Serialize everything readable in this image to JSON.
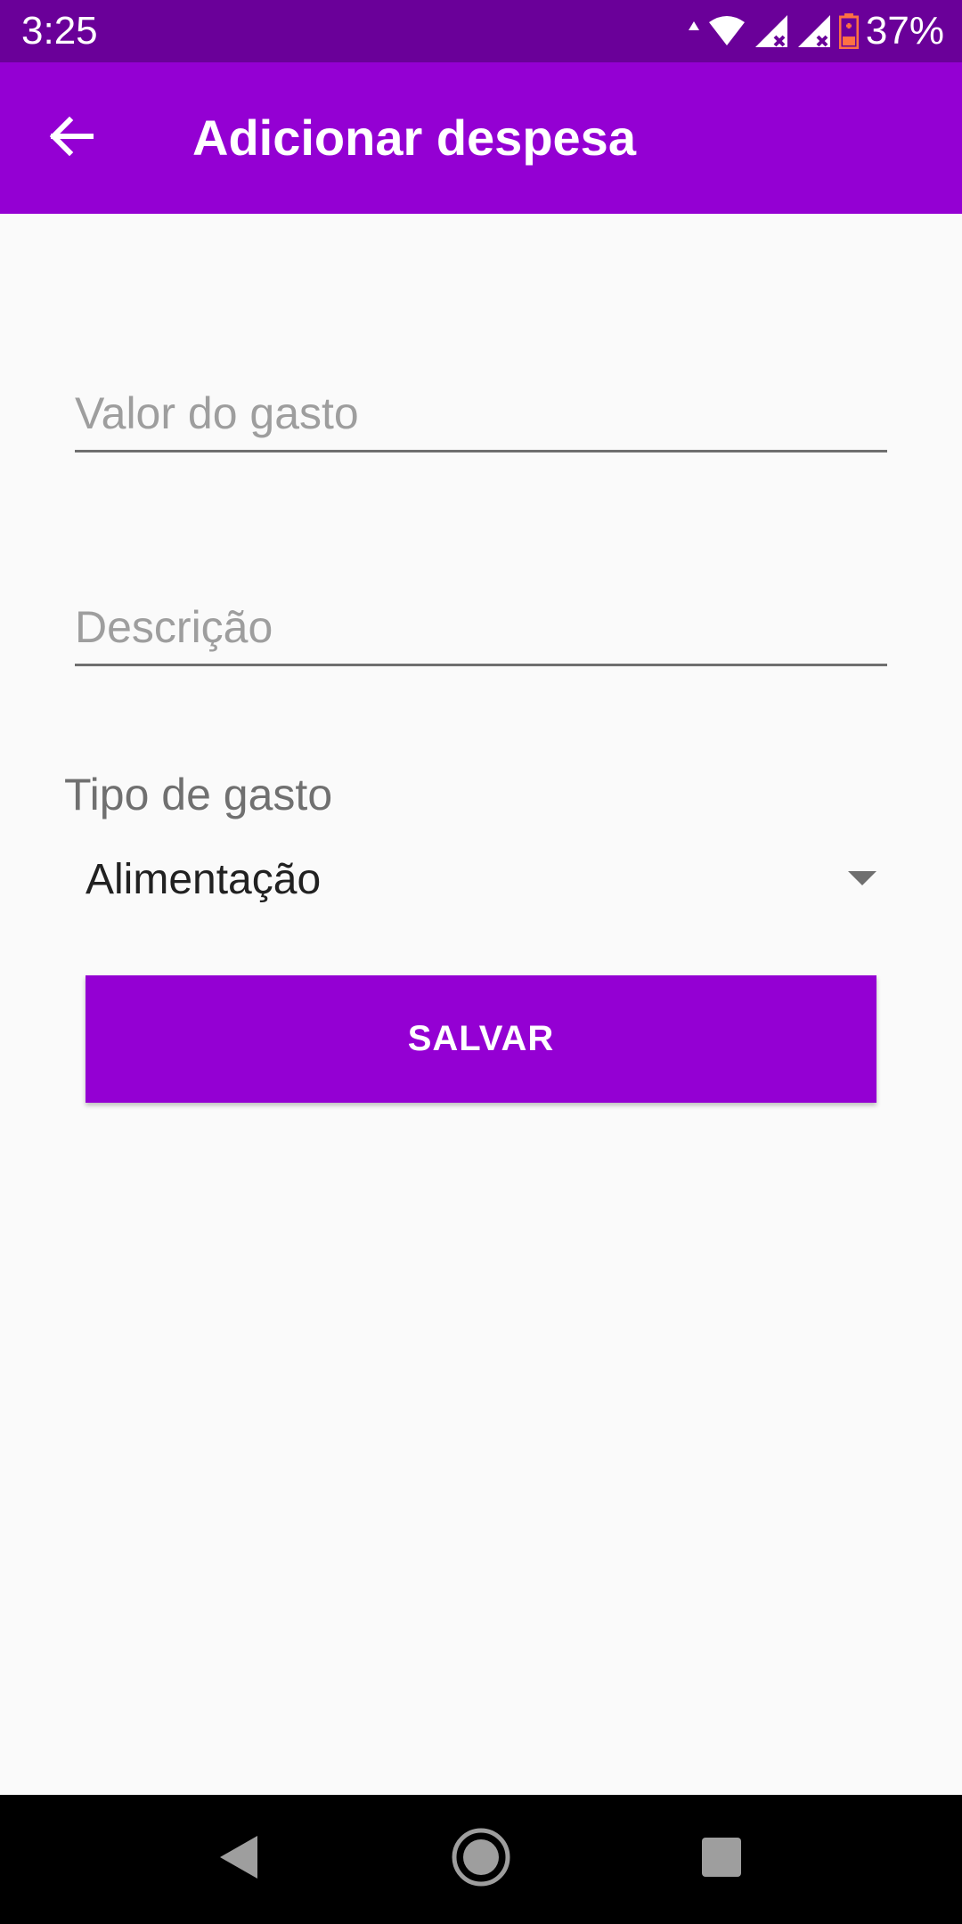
{
  "status_bar": {
    "time": "3:25",
    "battery_percent": "37%",
    "icons": [
      "data-arrows-icon",
      "wifi-icon",
      "signal-no-service-icon",
      "signal-no-service-icon",
      "battery-low-icon"
    ]
  },
  "app_bar": {
    "title": "Adicionar despesa",
    "back_icon": "arrow-back-icon"
  },
  "form": {
    "valor": {
      "placeholder": "Valor do gasto",
      "value": ""
    },
    "descricao": {
      "placeholder": "Descrição",
      "value": ""
    },
    "tipo_label": "Tipo de gasto",
    "tipo_selected": "Alimentação",
    "save_label": "SALVAR"
  },
  "navigation": {
    "buttons": [
      "back-triangle-icon",
      "home-circle-icon",
      "recents-square-icon"
    ]
  },
  "colors": {
    "status_bar": "#6a0099",
    "primary": "#9400d3",
    "background": "#fafafa",
    "battery_accent": "#ff7043"
  }
}
